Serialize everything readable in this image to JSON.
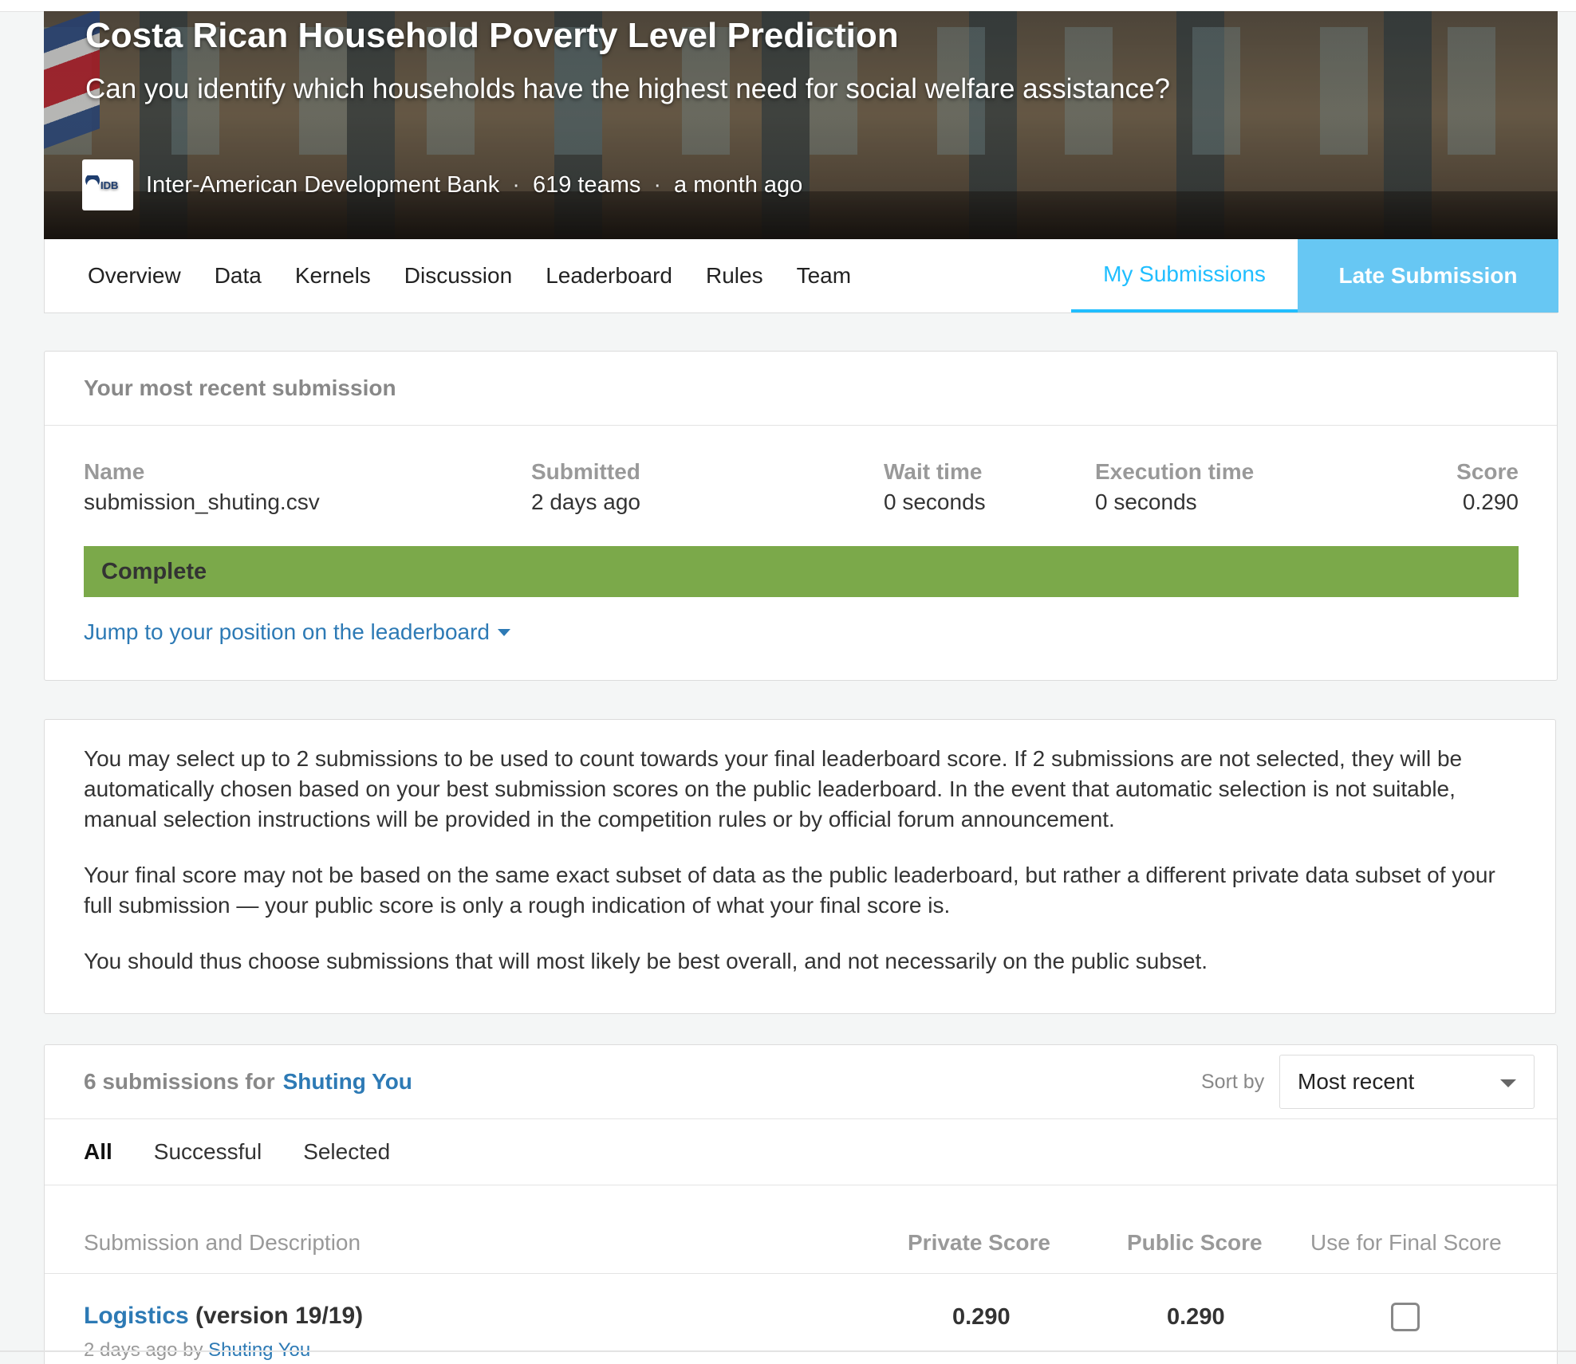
{
  "competition": {
    "title": "Costa Rican Household Poverty Level Prediction",
    "subtitle": "Can you identify which households have the highest need for social welfare assistance?",
    "host": "Inter-American Development Bank",
    "logo_text": "IDB",
    "teams": "619 teams",
    "time": "a month ago",
    "separator": "·"
  },
  "nav": {
    "items": [
      "Overview",
      "Data",
      "Kernels",
      "Discussion",
      "Leaderboard",
      "Rules",
      "Team"
    ],
    "my_submissions": "My Submissions",
    "late_submission": "Late Submission"
  },
  "recent": {
    "header": "Your most recent submission",
    "name_label": "Name",
    "name_value": "submission_shuting.csv",
    "submitted_label": "Submitted",
    "submitted_value": "2 days ago",
    "wait_label": "Wait time",
    "wait_value": "0 seconds",
    "exec_label": "Execution time",
    "exec_value": "0 seconds",
    "score_label": "Score",
    "score_value": "0.290",
    "status": "Complete",
    "jump_link": "Jump to your position on the leaderboard"
  },
  "info": {
    "p1": "You may select up to 2 submissions to be used to count towards your final leaderboard score. If 2 submissions are not selected, they will be automatically chosen based on your best submission scores on the public leaderboard. In the event that automatic selection is not suitable, manual selection instructions will be provided in the competition rules or by official forum announcement.",
    "p2": "Your final score may not be based on the same exact subset of data as the public leaderboard, but rather a different private data subset of your full submission — your public score is only a rough indication of what your final score is.",
    "p3": "You should thus choose submissions that will most likely be best overall, and not necessarily on the public subset."
  },
  "submissions": {
    "count_text": "6 submissions for",
    "user": "Shuting You",
    "sort_label": "Sort by",
    "sort_value": "Most recent",
    "filters": [
      "All",
      "Successful",
      "Selected"
    ],
    "columns": {
      "desc": "Submission and Description",
      "private": "Private Score",
      "public": "Public Score",
      "use": "Use for Final Score"
    },
    "rows": [
      {
        "name": "Logistics",
        "version": "(version 19/19)",
        "meta_prefix": "2 days ago by",
        "meta_user": "Shuting You",
        "private": "0.290",
        "public": "0.290",
        "selected": false
      }
    ]
  },
  "colors": {
    "accent": "#20beff",
    "late_button": "#67c7f3",
    "link": "#2d7ab5",
    "complete": "#7ba94a"
  }
}
